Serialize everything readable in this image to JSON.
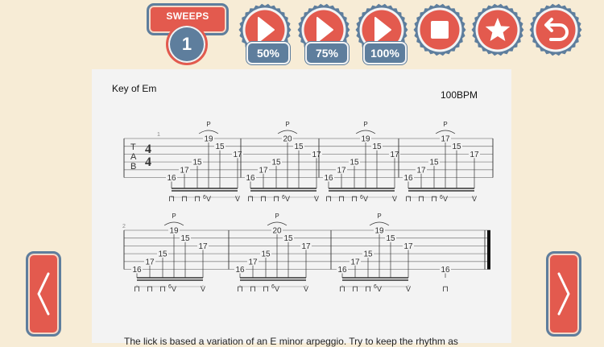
{
  "lesson": {
    "category": "SWEEPS",
    "number": "1"
  },
  "toolbar": {
    "speeds": [
      "50%",
      "75%",
      "100%"
    ],
    "icons": [
      "play-icon",
      "play-icon",
      "play-icon",
      "stop-icon",
      "star-icon",
      "undo-icon"
    ]
  },
  "sheet": {
    "key": "Key of Em",
    "bpm": "100BPM",
    "clef": [
      "T",
      "A",
      "B"
    ],
    "time_signature": [
      "4",
      "4"
    ],
    "measure_numbers": [
      "1",
      "2"
    ],
    "row1_notes": [
      [
        "16",
        "17",
        "15",
        "19",
        "15",
        "17"
      ],
      [
        "16",
        "17",
        "15",
        "20",
        "15",
        "17"
      ],
      [
        "16",
        "17",
        "15",
        "19",
        "15",
        "17"
      ],
      [
        "16",
        "17",
        "15",
        "17",
        "15",
        "17"
      ]
    ],
    "row2_notes": [
      [
        "16",
        "17",
        "15",
        "19",
        "15",
        "17"
      ],
      [
        "16",
        "17",
        "15",
        "20",
        "15",
        "17"
      ],
      [
        "16",
        "17",
        "15",
        "19",
        "15",
        "17"
      ]
    ],
    "row2_final_note": "16",
    "pull_off_mark": "P",
    "tuplet": "6",
    "pick_down": "⊓",
    "pick_up": "V",
    "description": "The lick is based a variation of an E minor arpeggio. Try to keep the rhythm as"
  },
  "colors": {
    "accent": "#e35a4e",
    "secondary": "#5e7e9d",
    "background": "#f7ecd6"
  }
}
